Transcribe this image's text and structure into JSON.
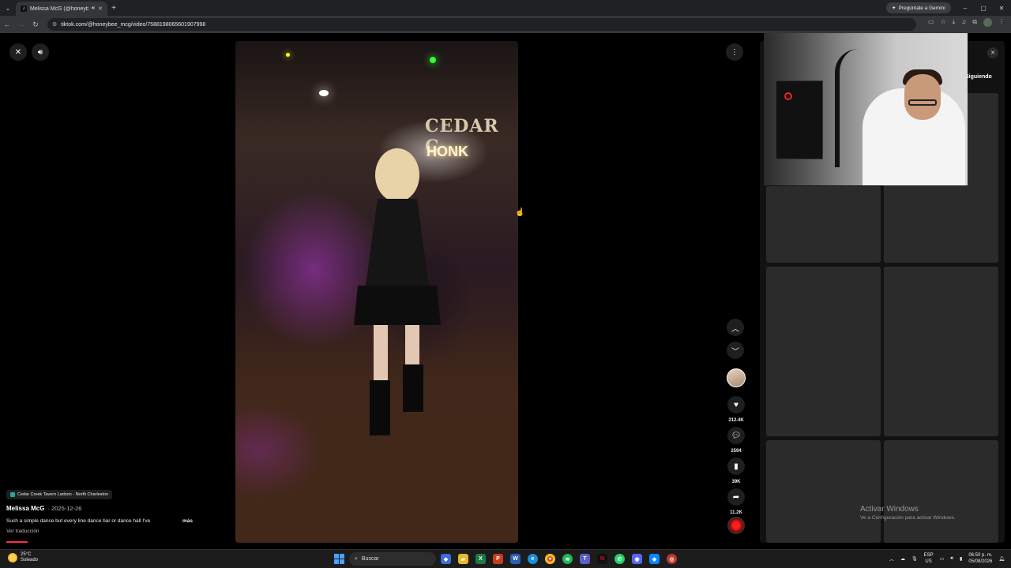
{
  "browser": {
    "tab_title": "Melissa McG (@honeybee...",
    "tab_favicon": "tiktok-icon",
    "gemini_label": "Pregúntale a Gemini",
    "url": "tiktok.com/@honeybee_mcg/video/7588198065601907998"
  },
  "video": {
    "sign_text": "CEDAR C",
    "sign_text2": "HONK"
  },
  "post": {
    "location": "Cedar Creek Tavern Ladson - North Charleston",
    "author": "Melissa McG",
    "date": "2025-12-26",
    "caption": "Such a simple dance but every line dance bar or dance hall I've",
    "more_label": "más",
    "translate_label": "Ver traducción",
    "progress": 0.03
  },
  "actions": {
    "likes": "212.4K",
    "comments": "2594",
    "saves": "39K",
    "shares": "11.2K"
  },
  "side_panel": {
    "following_label": "Siguiendo"
  },
  "watermark": {
    "line1": "Activar Windows",
    "line2": "Ve a Configuración para activar Windows."
  },
  "taskbar": {
    "temperature": "25°C",
    "weather": "Soleado",
    "search_placeholder": "Buscar",
    "lang1": "ESP",
    "lang2": "US",
    "time": "06:50 p. m.",
    "date": "05/08/2026"
  },
  "colors": {
    "accent": "#fe2c55",
    "panel_bg": "#121212",
    "taskbar_bg": "#1c1c1c"
  }
}
